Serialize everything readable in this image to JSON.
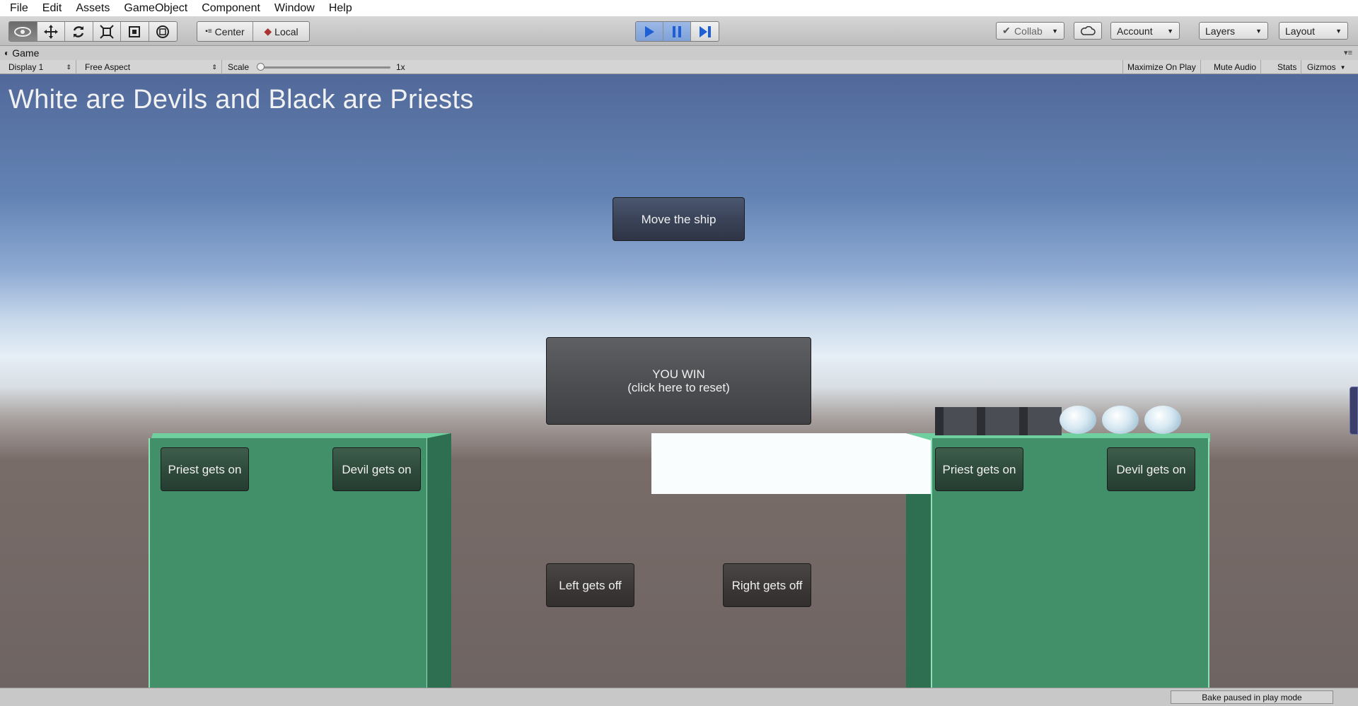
{
  "menu": [
    "File",
    "Edit",
    "Assets",
    "GameObject",
    "Component",
    "Window",
    "Help"
  ],
  "toolbar": {
    "pivot_label": "Center",
    "space_label": "Local",
    "collab_label": "Collab",
    "account_label": "Account",
    "layers_label": "Layers",
    "layout_label": "Layout"
  },
  "game_tab": {
    "label": "Game",
    "display": "Display 1",
    "aspect": "Free Aspect",
    "scale_label": "Scale",
    "scale_value": "1x",
    "maximize": "Maximize On Play",
    "mute": "Mute Audio",
    "stats": "Stats",
    "gizmos": "Gizmos"
  },
  "game": {
    "title": "White are Devils and Black are Priests",
    "move_ship": "Move the ship",
    "win_line1": "YOU WIN",
    "win_line2": "(click here to reset)",
    "left_priest_on": "Priest gets on",
    "left_devil_on": "Devil gets on",
    "right_priest_on": "Priest gets on",
    "right_devil_on": "Devil gets on",
    "left_off": "Left gets off",
    "right_off": "Right gets off"
  },
  "status": {
    "bake": "Bake paused in play mode"
  },
  "colors": {
    "bank_green": "#42906a",
    "boat_white": "#fafdfd",
    "play_blue": "#2f6fdc"
  }
}
